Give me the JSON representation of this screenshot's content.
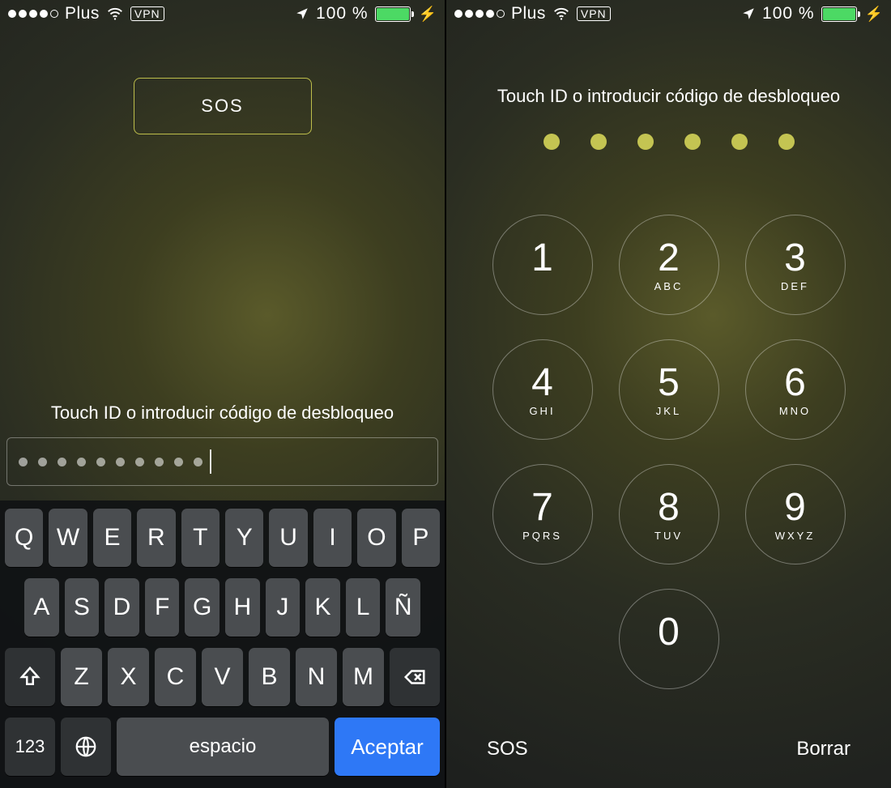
{
  "status": {
    "carrier": "Plus",
    "vpn": "VPN",
    "battery_pct": "100 %",
    "signal_filled": 4,
    "signal_total": 5
  },
  "left": {
    "sos": "SOS",
    "prompt": "Touch ID o introducir código de desbloqueo",
    "typed_dots": 10,
    "keyboard": {
      "row1": [
        "Q",
        "W",
        "E",
        "R",
        "T",
        "Y",
        "U",
        "I",
        "O",
        "P"
      ],
      "row2": [
        "A",
        "S",
        "D",
        "F",
        "G",
        "H",
        "J",
        "K",
        "L",
        "Ñ"
      ],
      "row3": [
        "Z",
        "X",
        "C",
        "V",
        "B",
        "N",
        "M"
      ],
      "numKey": "123",
      "space": "espacio",
      "accept": "Aceptar"
    }
  },
  "right": {
    "prompt": "Touch ID o introducir código de desbloqueo",
    "code_length": 6,
    "keys": [
      {
        "d": "1",
        "l": ""
      },
      {
        "d": "2",
        "l": "ABC"
      },
      {
        "d": "3",
        "l": "DEF"
      },
      {
        "d": "4",
        "l": "GHI"
      },
      {
        "d": "5",
        "l": "JKL"
      },
      {
        "d": "6",
        "l": "MNO"
      },
      {
        "d": "7",
        "l": "PQRS"
      },
      {
        "d": "8",
        "l": "TUV"
      },
      {
        "d": "9",
        "l": "WXYZ"
      },
      {
        "d": "0",
        "l": ""
      }
    ],
    "sos": "SOS",
    "delete": "Borrar"
  }
}
